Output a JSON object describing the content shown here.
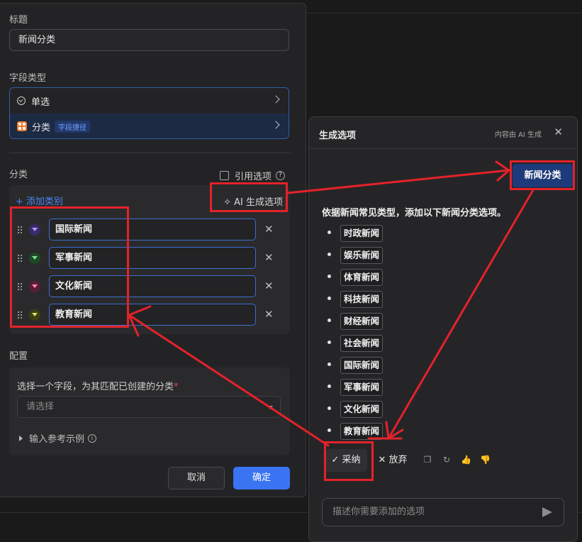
{
  "left": {
    "title_label": "标题",
    "title_value": "新闻分类",
    "field_type_label": "字段类型",
    "type_options": [
      {
        "label": "单选"
      },
      {
        "label": "分类",
        "tag": "字段捷径"
      }
    ],
    "category_label": "分类",
    "cite_label": "引用选项",
    "add_category": "+ 添加类别",
    "ai_generate": "✧ AI 生成选项",
    "options": [
      {
        "label": "国际新闻",
        "color": "#6a3fd1"
      },
      {
        "label": "军事新闻",
        "color": "#2d8a3e"
      },
      {
        "label": "文化新闻",
        "color": "#c0336e"
      },
      {
        "label": "教育新闻",
        "color": "#8a8a1f"
      }
    ],
    "config_label": "配置",
    "config_field_label": "选择一个字段，为其匹配已创建的分类",
    "config_required": "*",
    "select_placeholder": "请选择",
    "ref_example": "输入参考示例",
    "cancel": "取消",
    "ok": "确定"
  },
  "right": {
    "title": "生成选项",
    "note": "内容由 AI 生成",
    "user_message": "新闻分类",
    "ai_intro": "依据新闻常见类型，添加以下新闻分类选项。",
    "items": [
      "时政新闻",
      "娱乐新闻",
      "体育新闻",
      "科技新闻",
      "财经新闻",
      "社会新闻",
      "国际新闻",
      "军事新闻",
      "文化新闻",
      "教育新闻"
    ],
    "adopt": "✓ 采纳",
    "discard": "✕ 放弃",
    "prompt_placeholder": "描述你需要添加的选项"
  },
  "colors": {
    "accent": "#3a74f2",
    "annotation_red": "#e3222a"
  }
}
